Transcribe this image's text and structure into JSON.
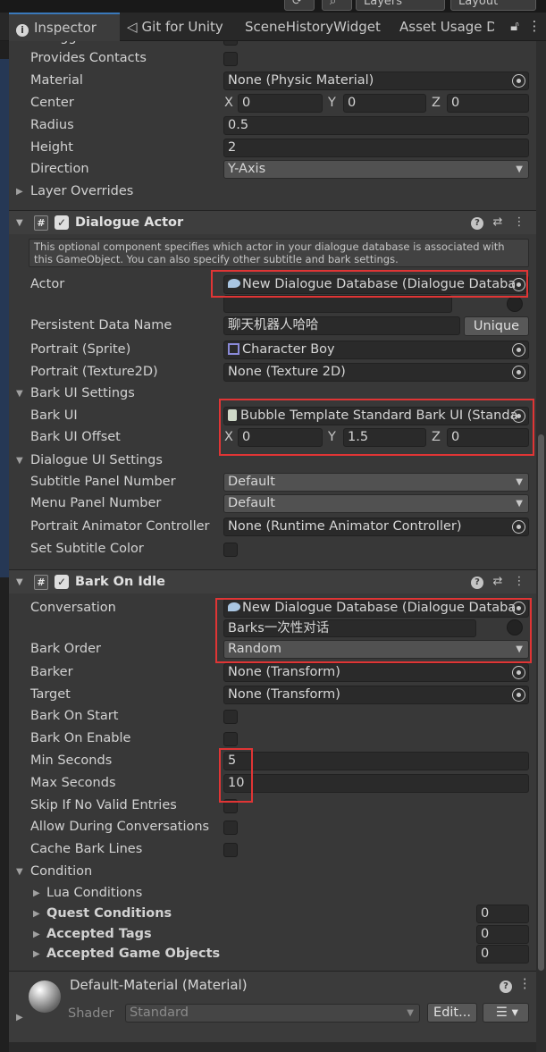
{
  "top_strip": {
    "layers_label": "Layers",
    "layout_label": "Layout"
  },
  "tabs": [
    {
      "label": "Inspector"
    },
    {
      "label": "Git for Unity"
    },
    {
      "label": "SceneHistoryWidget"
    },
    {
      "label": "Asset Usage D"
    }
  ],
  "collider": {
    "is_trigger_label": "Is Trigger",
    "provides_contacts_label": "Provides Contacts",
    "material_label": "Material",
    "material_value": "None (Physic Material)",
    "center_label": "Center",
    "center": {
      "x_label": "X",
      "x": "0",
      "y_label": "Y",
      "y": "0",
      "z_label": "Z",
      "z": "0"
    },
    "radius_label": "Radius",
    "radius_value": "0.5",
    "height_label": "Height",
    "height_value": "2",
    "direction_label": "Direction",
    "direction_value": "Y-Axis",
    "layer_overrides_label": "Layer Overrides"
  },
  "dialogue_actor": {
    "title": "Dialogue Actor",
    "enabled": true,
    "help_text": "This optional component specifies which actor in your dialogue database is associated with this GameObject. You can also specify other subtitle and bark settings.",
    "actor_label": "Actor",
    "actor_value": "New Dialogue Database (Dialogue Databa",
    "persistent_label": "Persistent Data Name",
    "persistent_value": "聊天机器人哈哈",
    "unique_button": "Unique",
    "portrait_sprite_label": "Portrait (Sprite)",
    "portrait_sprite_value": "Character Boy",
    "portrait_tex_label": "Portrait (Texture2D)",
    "portrait_tex_value": "None (Texture 2D)",
    "bark_ui_settings_label": "Bark UI Settings",
    "bark_ui_label": "Bark UI",
    "bark_ui_value": "Bubble Template Standard Bark UI (Standa",
    "bark_offset_label": "Bark UI Offset",
    "bark_offset": {
      "x_label": "X",
      "x": "0",
      "y_label": "Y",
      "y": "1.5",
      "z_label": "Z",
      "z": "0"
    },
    "dialogue_ui_settings_label": "Dialogue UI Settings",
    "subtitle_panel_label": "Subtitle Panel Number",
    "subtitle_panel_value": "Default",
    "menu_panel_label": "Menu Panel Number",
    "menu_panel_value": "Default",
    "portrait_anim_label": "Portrait Animator Controller",
    "portrait_anim_value": "None (Runtime Animator Controller)",
    "set_subtitle_color_label": "Set Subtitle Color"
  },
  "bark_on_idle": {
    "title": "Bark On Idle",
    "enabled": true,
    "conversation_label": "Conversation",
    "conversation_value": "New Dialogue Database (Dialogue Databa",
    "conversation_sub": "Barks一次性对话",
    "bark_order_label": "Bark Order",
    "bark_order_value": "Random",
    "barker_label": "Barker",
    "barker_value": "None (Transform)",
    "target_label": "Target",
    "target_value": "None (Transform)",
    "bark_on_start_label": "Bark On Start",
    "bark_on_enable_label": "Bark On Enable",
    "min_seconds_label": "Min Seconds",
    "min_seconds_value": "5",
    "max_seconds_label": "Max Seconds",
    "max_seconds_value": "10",
    "skip_label": "Skip If No Valid Entries",
    "allow_label": "Allow During Conversations",
    "cache_label": "Cache Bark Lines",
    "condition_label": "Condition",
    "lua_label": "Lua Conditions",
    "quest_label": "Quest Conditions",
    "quest_count": "0",
    "tags_label": "Accepted Tags",
    "tags_count": "0",
    "gameobjects_label": "Accepted Game Objects",
    "gameobjects_count": "0"
  },
  "material": {
    "title": "Default-Material (Material)",
    "shader_label": "Shader",
    "shader_value": "Standard",
    "edit_button": "Edit..."
  },
  "colors": {
    "highlight_red": "#e03535",
    "accent_blue": "#3a79bb"
  }
}
